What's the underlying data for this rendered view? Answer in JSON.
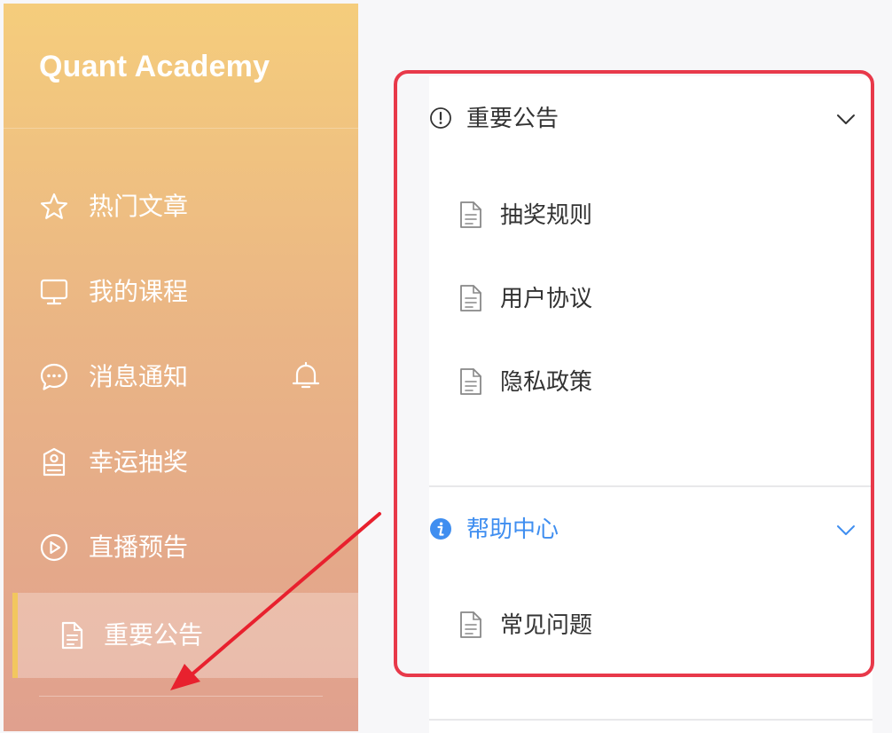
{
  "sidebar": {
    "brand": "Quant Academy",
    "items": [
      {
        "label": "热门文章",
        "icon": "star-icon"
      },
      {
        "label": "我的课程",
        "icon": "monitor-icon"
      },
      {
        "label": "消息通知",
        "icon": "chat-icon"
      },
      {
        "label": "幸运抽奖",
        "icon": "badge-icon"
      },
      {
        "label": "直播预告",
        "icon": "play-circle-icon"
      },
      {
        "label": "重要公告",
        "icon": "document-icon",
        "active": true
      }
    ],
    "notification_icon": "bell-icon"
  },
  "panel": {
    "sections": [
      {
        "title": "重要公告",
        "icon": "exclamation-circle-icon",
        "expanded": true,
        "items": [
          "抽奖规则",
          "用户协议",
          "隐私政策"
        ]
      },
      {
        "title": "帮助中心",
        "icon": "info-circle-icon",
        "expanded": true,
        "color": "#3f8ef0",
        "items": [
          "常见问题"
        ]
      }
    ]
  },
  "colors": {
    "accent": "#f2c75e",
    "highlight_border": "#e8394a",
    "arrow": "#e8212e",
    "link_blue": "#3f8ef0"
  }
}
